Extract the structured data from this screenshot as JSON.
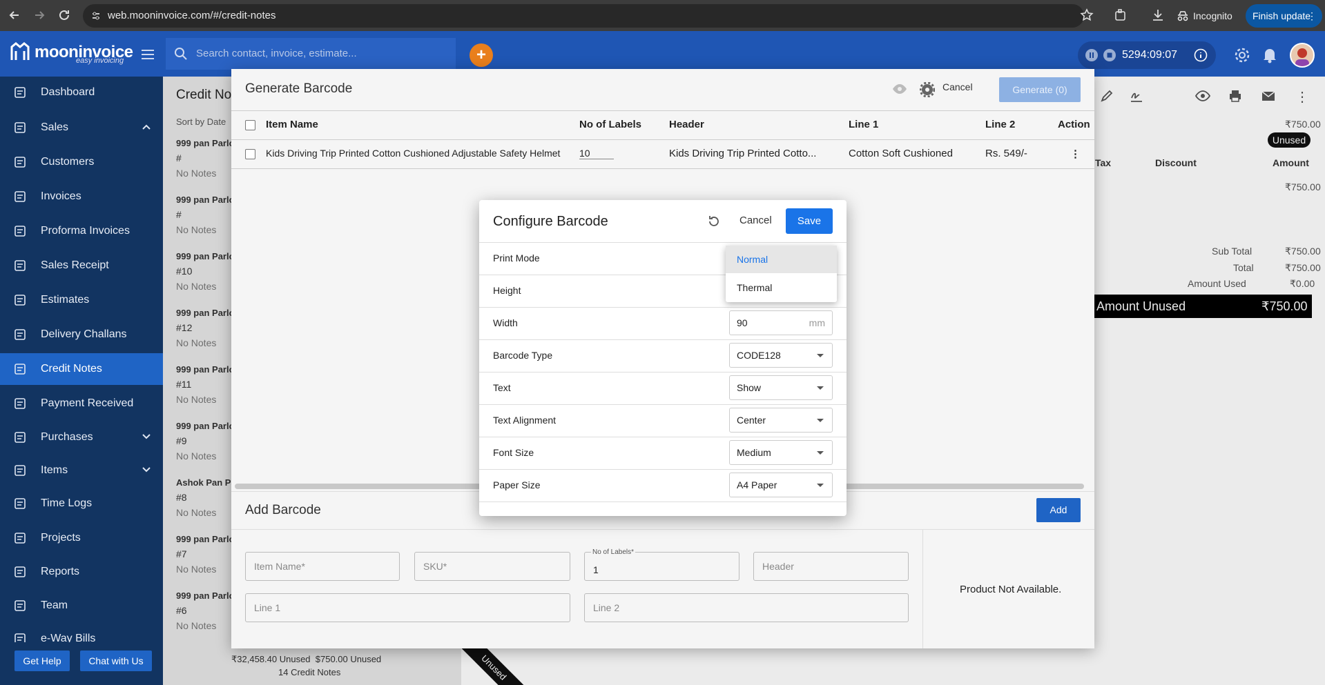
{
  "browser": {
    "url": "web.mooninvoice.com/#/credit-notes",
    "incognito_label": "Incognito",
    "finish_update_label": "Finish update"
  },
  "app": {
    "logo_text": "mooninvoice",
    "logo_sub": "easy invoicing",
    "search_placeholder": "Search contact, invoice, estimate...",
    "timer": "5294:09:07"
  },
  "sidebar": {
    "items": [
      {
        "label": "Dashboard",
        "icon": "home-icon"
      },
      {
        "label": "Sales",
        "icon": "dollar-icon"
      },
      {
        "label": "Customers",
        "icon": "contacts-icon"
      },
      {
        "label": "Invoices",
        "icon": "document-icon"
      },
      {
        "label": "Proforma Invoices",
        "icon": "document-icon"
      },
      {
        "label": "Sales Receipt",
        "icon": "receipt-icon"
      },
      {
        "label": "Estimates",
        "icon": "calculator-icon"
      },
      {
        "label": "Delivery Challans",
        "icon": "truck-icon"
      },
      {
        "label": "Credit Notes",
        "icon": "credit-note-icon"
      },
      {
        "label": "Payment Received",
        "icon": "payment-icon"
      },
      {
        "label": "Purchases",
        "icon": "cart-icon"
      },
      {
        "label": "Items",
        "icon": "list-icon"
      },
      {
        "label": "Time Logs",
        "icon": "clock-icon"
      },
      {
        "label": "Projects",
        "icon": "folder-icon"
      },
      {
        "label": "Reports",
        "icon": "chart-icon"
      },
      {
        "label": "Team",
        "icon": "team-icon"
      },
      {
        "label": "e-Way Bills",
        "icon": "truck-icon"
      }
    ],
    "get_help": "Get Help",
    "chat": "Chat with Us"
  },
  "list": {
    "title": "Credit No",
    "sort": "Sort by Date",
    "rows": [
      {
        "name": "999 pan Parlo",
        "num": "#",
        "notes": "No Notes"
      },
      {
        "name": "999 pan Parlo",
        "num": "#",
        "notes": "No Notes"
      },
      {
        "name": "999 pan Parlo",
        "num": "#10",
        "notes": "No Notes"
      },
      {
        "name": "999 pan Parlo",
        "num": "#12",
        "notes": "No Notes"
      },
      {
        "name": "999 pan Parlo",
        "num": "#11",
        "notes": "No Notes"
      },
      {
        "name": "999 pan Parlo",
        "num": "#9",
        "notes": "No Notes"
      },
      {
        "name": "Ashok Pan Pa",
        "num": "#8",
        "notes": "No Notes"
      },
      {
        "name": "999 pan Parlo",
        "num": "#7",
        "notes": "No Notes"
      },
      {
        "name": "999 pan Parlo",
        "num": "#6",
        "notes": "No Notes"
      }
    ],
    "footer_amounts": "₹32,458.40 Unused  $750.00 Unused",
    "footer_count": "14 Credit Notes",
    "ribbon": "Unused"
  },
  "detail": {
    "amount_top": "₹750.00",
    "status": "Unused",
    "col_tax": "Tax",
    "col_discount": "Discount",
    "col_amount": "Amount",
    "line_amount": "₹750.00",
    "sub_total_label": "Sub Total",
    "sub_total": "₹750.00",
    "total_label": "Total",
    "total": "₹750.00",
    "amount_used_label": "Amount Used",
    "amount_used": "₹0.00",
    "amount_unused_label": "Amount Unused",
    "amount_unused": "₹750.00"
  },
  "generate": {
    "title": "Generate Barcode",
    "cancel": "Cancel",
    "generate": "Generate (0)",
    "headers": [
      "Item Name",
      "No of Labels",
      "Header",
      "Line 1",
      "Line 2",
      "Action"
    ],
    "row": {
      "item": "Kids Driving Trip Printed Cotton Cushioned Adjustable Safety Helmet",
      "labels": "10",
      "header": "Kids Driving Trip Printed Cotto...",
      "line1": "Cotton Soft Cushioned",
      "line2": "Rs. 549/-"
    },
    "add_title": "Add Barcode",
    "add_button": "Add",
    "fields": {
      "item_name": "Item Name*",
      "sku": "SKU*",
      "labels_label": "No of Labels*",
      "labels_value": "1",
      "header": "Header",
      "line1": "Line 1",
      "line2": "Line 2"
    },
    "product_na": "Product Not Available."
  },
  "config": {
    "title": "Configure Barcode",
    "cancel": "Cancel",
    "save": "Save",
    "rows": [
      {
        "label": "Print Mode",
        "value": ""
      },
      {
        "label": "Height",
        "value": ""
      },
      {
        "label": "Width",
        "value": "90",
        "unit": "mm"
      },
      {
        "label": "Barcode Type",
        "value": "CODE128"
      },
      {
        "label": "Text",
        "value": "Show"
      },
      {
        "label": "Text Alignment",
        "value": "Center"
      },
      {
        "label": "Font Size",
        "value": "Medium"
      },
      {
        "label": "Paper Size",
        "value": "A4 Paper"
      }
    ],
    "menu_options": [
      "Normal",
      "Thermal"
    ],
    "menu_selected": "Normal"
  },
  "colors": {
    "header_blue": "#1f56b4",
    "sidebar_navy": "#123461",
    "accent_blue": "#1a74e8",
    "orange": "#e97f1c"
  }
}
